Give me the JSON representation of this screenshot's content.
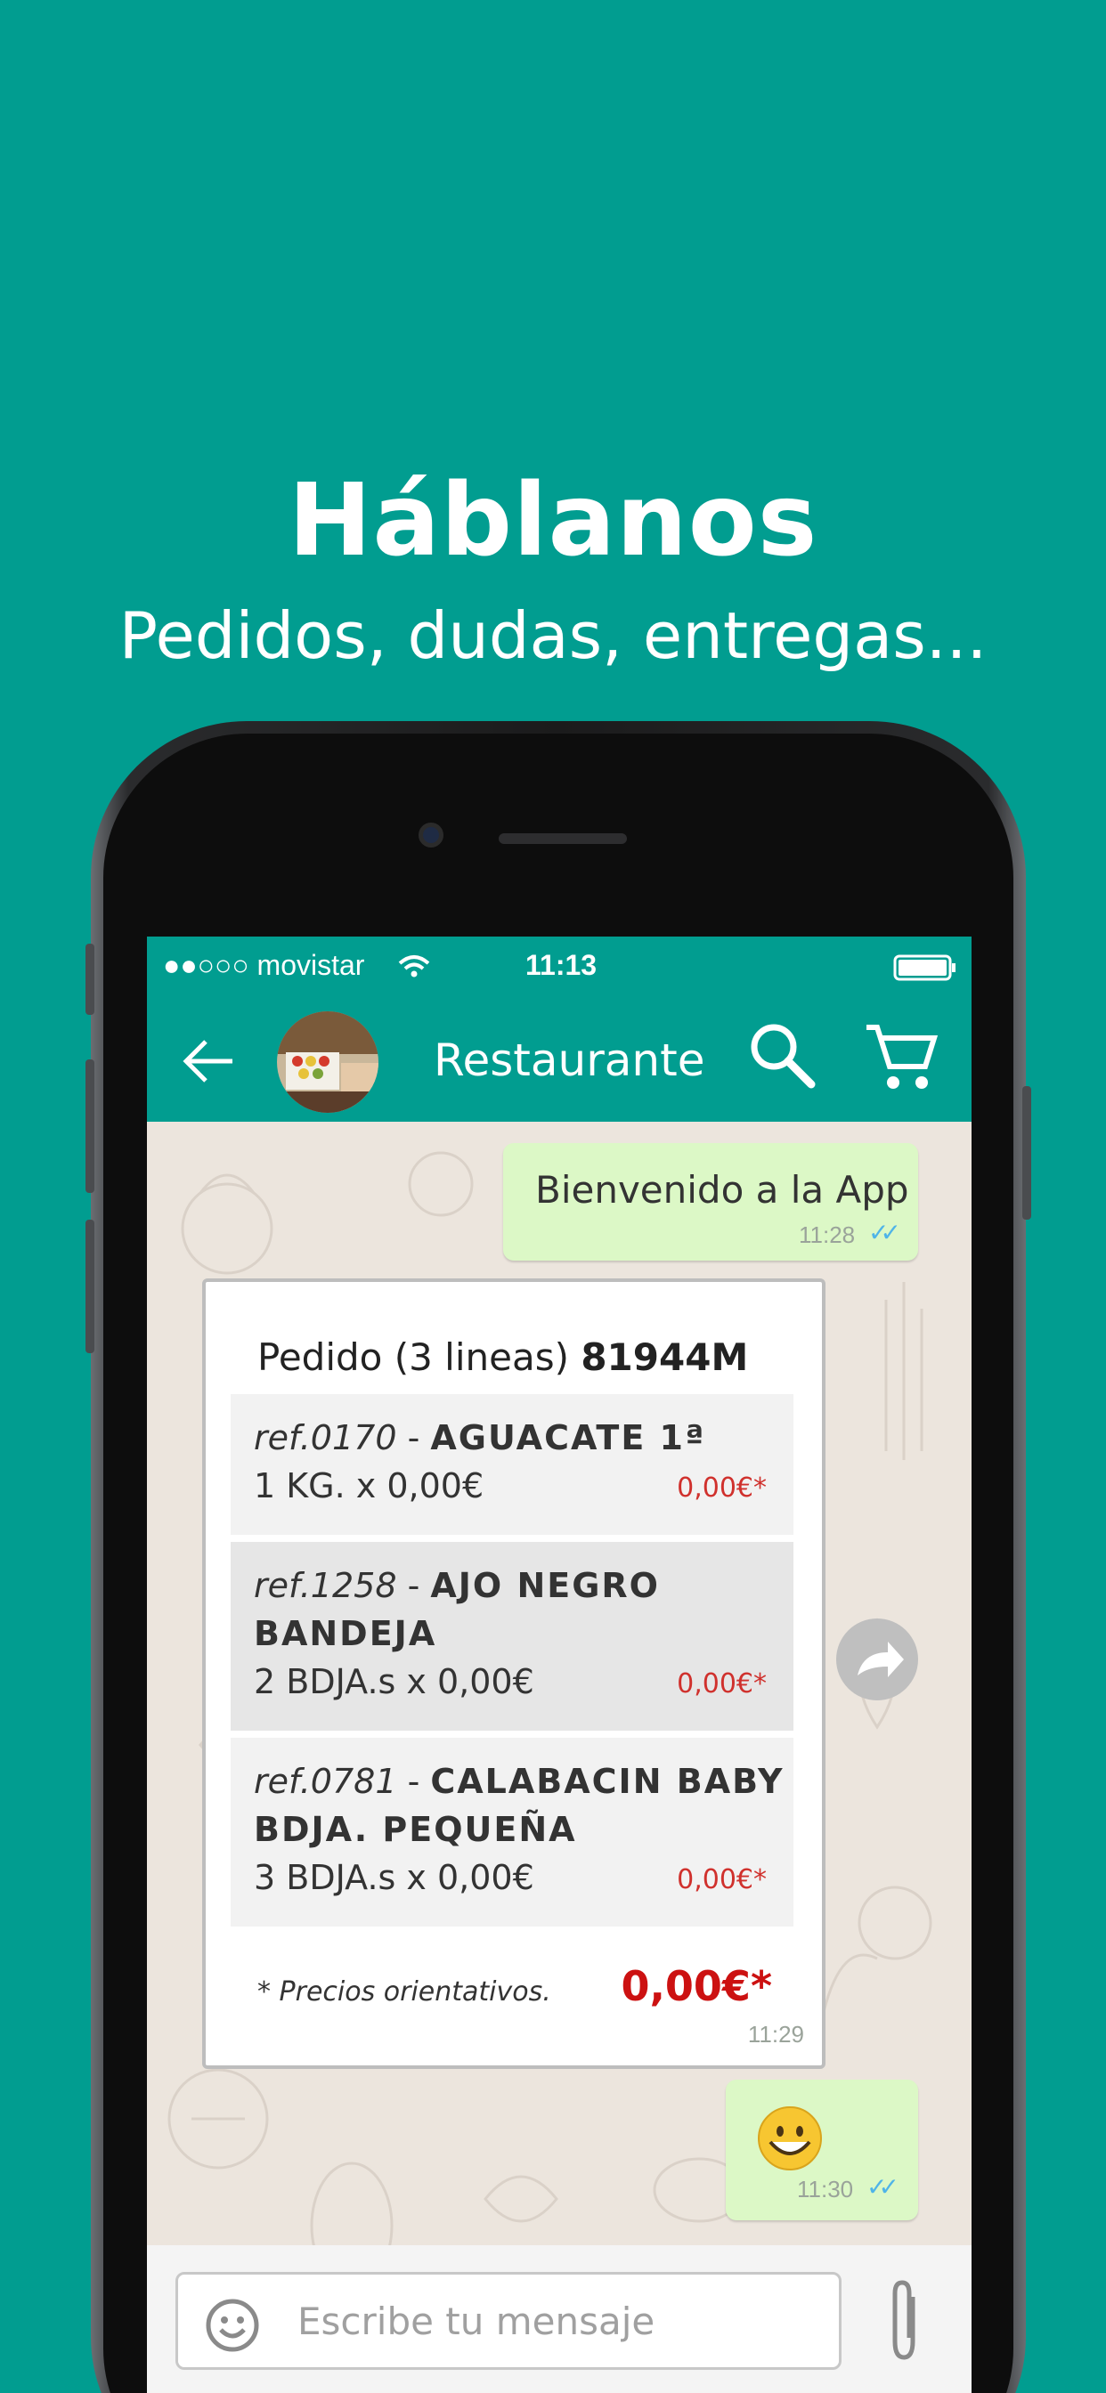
{
  "promo": {
    "title": "Háblanos",
    "subtitle": "Pedidos, dudas, entregas..."
  },
  "status_bar": {
    "carrier": "●●○○○ movistar",
    "time": "11:13"
  },
  "app_bar": {
    "title": "Restaurante",
    "icons": [
      "back-arrow-icon",
      "avatar",
      "search-icon",
      "cart-icon"
    ]
  },
  "messages": [
    {
      "text": "Bienvenido a la App",
      "time": "11:28"
    },
    {
      "text": "",
      "emoji": "smile",
      "time": "11:30"
    }
  ],
  "order": {
    "title_prefix": "Pedido (3 lineas)",
    "order_id": "81944M",
    "lines": [
      {
        "ref": "ref.0170",
        "sep": " - ",
        "name": "AGUACATE 1ª",
        "name2": "",
        "qty": "1 KG. x 0,00€",
        "price": "0,00€*"
      },
      {
        "ref": "ref.1258",
        "sep": " - ",
        "name": "AJO NEGRO",
        "name2": "BANDEJA",
        "qty": "2 BDJA.s x 0,00€",
        "price": "0,00€*"
      },
      {
        "ref": "ref.0781",
        "sep": " - ",
        "name": "CALABACIN BABY",
        "name2": "BDJA. PEQUEÑA",
        "qty": "3 BDJA.s x 0,00€",
        "price": "0,00€*"
      }
    ],
    "note": "* Precios orientativos.",
    "total": "0,00€*",
    "time": "11:29"
  },
  "composer": {
    "placeholder": "Escribe tu mensaje"
  },
  "colors": {
    "brand": "#019d90",
    "outgoing_bubble": "#dcf8c6",
    "price_red": "#d0312d",
    "tick_blue": "#4fb4e8"
  }
}
